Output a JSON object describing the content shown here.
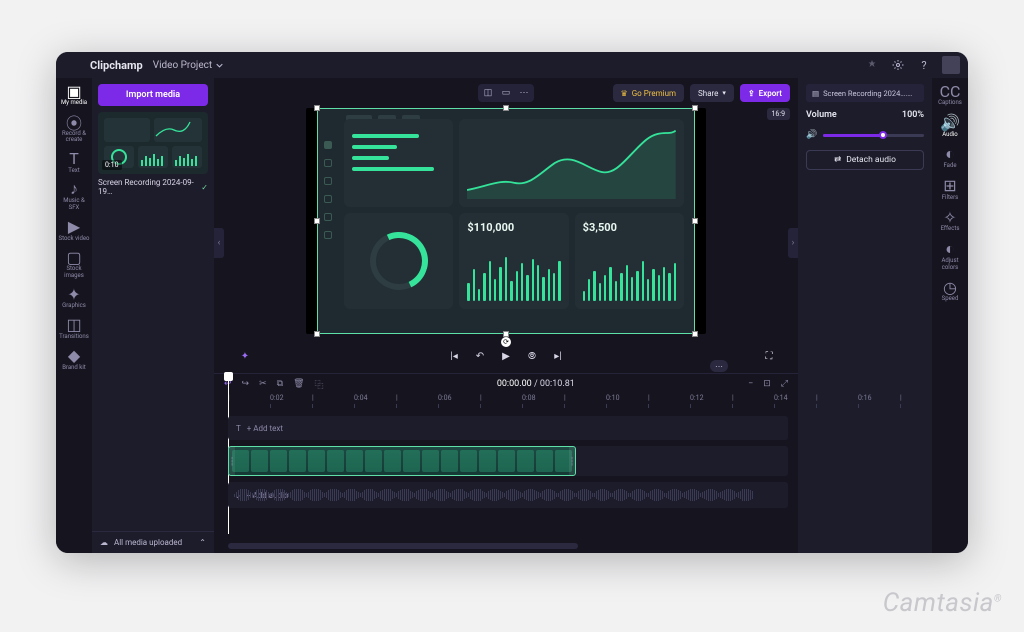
{
  "brand": "Clipchamp",
  "project_name": "Video Project",
  "topbar": {
    "go_premium": "Go Premium",
    "share": "Share",
    "export": "Export"
  },
  "rails": {
    "left": [
      {
        "id": "my-media",
        "label": "My media",
        "active": true
      },
      {
        "id": "record",
        "label": "Record & create"
      },
      {
        "id": "text",
        "label": "Text"
      },
      {
        "id": "music",
        "label": "Music & SFX"
      },
      {
        "id": "stock-video",
        "label": "Stock video"
      },
      {
        "id": "stock-images",
        "label": "Stock images"
      },
      {
        "id": "graphics",
        "label": "Graphics"
      },
      {
        "id": "transitions",
        "label": "Transitions"
      },
      {
        "id": "brand-kit",
        "label": "Brand kit"
      }
    ],
    "right": [
      {
        "id": "captions",
        "label": "Captions"
      },
      {
        "id": "audio",
        "label": "Audio",
        "active": true
      },
      {
        "id": "fade",
        "label": "Fade"
      },
      {
        "id": "filters",
        "label": "Filters"
      },
      {
        "id": "effects",
        "label": "Effects"
      },
      {
        "id": "adjust",
        "label": "Adjust colors"
      },
      {
        "id": "speed",
        "label": "Speed"
      }
    ]
  },
  "media": {
    "import_label": "Import media",
    "thumb_duration": "0:10",
    "thumb_name": "Screen Recording 2024-09-19…",
    "footer": "All media uploaded"
  },
  "canvas": {
    "aspect_ratio": "16:9",
    "dashboard": {
      "metric1": "$110,000",
      "metric2": "$3,500",
      "hbars_w": [
        72,
        48,
        40,
        88
      ],
      "mini1": [
        18,
        32,
        12,
        28,
        40,
        22,
        34,
        44,
        20,
        30,
        38,
        26,
        42,
        36,
        24,
        32,
        28,
        40
      ],
      "mini2": [
        10,
        22,
        30,
        18,
        26,
        34,
        20,
        28,
        36,
        24,
        30,
        40,
        22,
        32,
        26,
        34,
        28,
        38
      ],
      "line_path": "M0,70 C20,66 34,58 48,62 C64,66 74,52 90,40 C108,28 122,46 138,50 C154,54 166,30 184,14 C198,2 208,10 214,4"
    }
  },
  "transport": {
    "current": "00:00.00",
    "total": "00:10.81"
  },
  "ruler_ticks": [
    "|",
    "0:02",
    "|",
    "0:04",
    "|",
    "0:06",
    "|",
    "0:08",
    "|",
    "0:10",
    "|",
    "0:12",
    "|",
    "0:14",
    "|",
    "0:16",
    "|"
  ],
  "tracks": {
    "text_placeholder": "+ Add text",
    "audio_placeholder": "+ Add audio"
  },
  "props": {
    "file_chip": "Screen Recording 2024….mov",
    "volume_label": "Volume",
    "volume_value": "100%",
    "detach_label": "Detach audio"
  },
  "watermark": "Camtasia"
}
